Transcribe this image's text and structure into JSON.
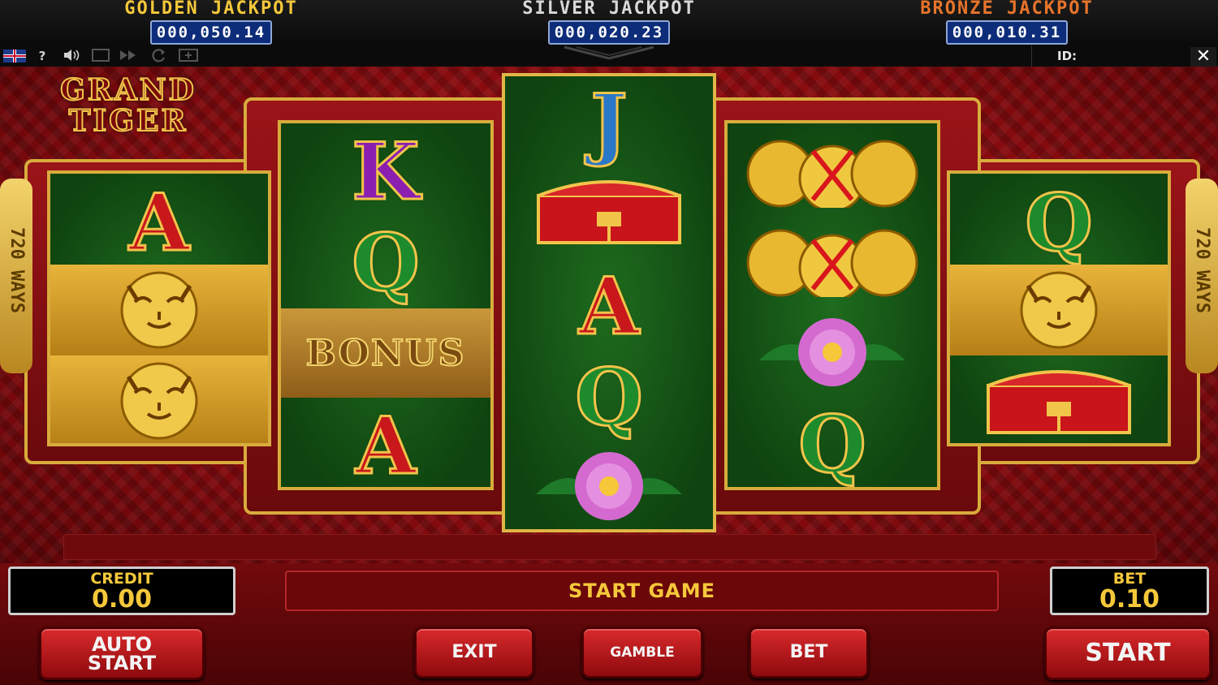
{
  "jackpots": [
    {
      "title": "GOLDEN JACKPOT",
      "value": "000,050.14"
    },
    {
      "title": "SILVER JACKPOT",
      "value": "000,020.23"
    },
    {
      "title": "BRONZE JACKPOT",
      "value": "000,010.31"
    }
  ],
  "toolbar": {
    "help": "?",
    "id_label": "ID:",
    "close": "✕",
    "icons": [
      "uk-flag-icon",
      "help-icon",
      "sound-icon",
      "fullscreen-icon",
      "fast-forward-icon",
      "refresh-icon",
      "history-icon"
    ]
  },
  "game": {
    "logo_line1": "GRAND",
    "logo_line2": "TIGER",
    "ways_left": "720 WAYS",
    "ways_right": "720 WAYS",
    "reels": [
      [
        "A",
        "tiger",
        "tiger"
      ],
      [
        "K",
        "Q",
        "BONUS",
        "A"
      ],
      [
        "J",
        "chest",
        "A",
        "Q",
        "peony"
      ],
      [
        "coins",
        "coins",
        "peony",
        "Q"
      ],
      [
        "Q",
        "tiger",
        "chest"
      ]
    ]
  },
  "controls": {
    "credit_label": "CREDIT",
    "credit_value": "0.00",
    "message": "START GAME",
    "bet_label": "BET",
    "bet_value": "0.10",
    "auto_start_line1": "AUTO",
    "auto_start_line2": "START",
    "exit": "EXIT",
    "gamble": "GAMBLE",
    "bet": "BET",
    "start": "START"
  },
  "colors": {
    "gold": "#f5c83a",
    "reel_green": "#0f4410",
    "background_red": "#8a0c10",
    "letter_A": "#c8181c",
    "letter_K": "#8a1fb0",
    "letter_Q": "#1d8a2c",
    "letter_J": "#2a78c8"
  }
}
